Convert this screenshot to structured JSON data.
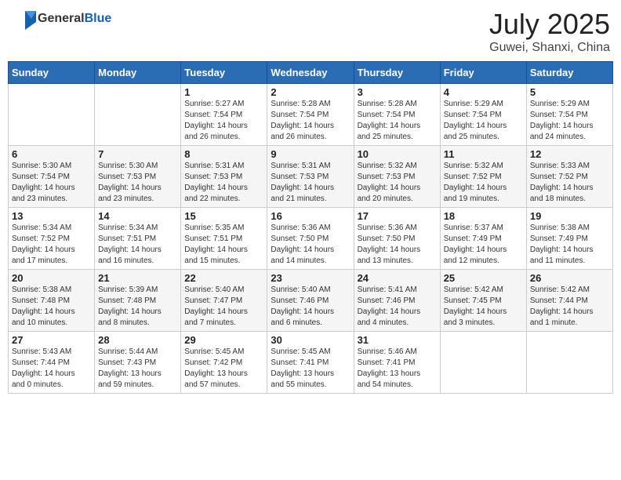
{
  "header": {
    "logo_general": "General",
    "logo_blue": "Blue",
    "month": "July 2025",
    "location": "Guwei, Shanxi, China"
  },
  "weekdays": [
    "Sunday",
    "Monday",
    "Tuesday",
    "Wednesday",
    "Thursday",
    "Friday",
    "Saturday"
  ],
  "weeks": [
    [
      {
        "day": "",
        "info": ""
      },
      {
        "day": "",
        "info": ""
      },
      {
        "day": "1",
        "info": "Sunrise: 5:27 AM\nSunset: 7:54 PM\nDaylight: 14 hours\nand 26 minutes."
      },
      {
        "day": "2",
        "info": "Sunrise: 5:28 AM\nSunset: 7:54 PM\nDaylight: 14 hours\nand 26 minutes."
      },
      {
        "day": "3",
        "info": "Sunrise: 5:28 AM\nSunset: 7:54 PM\nDaylight: 14 hours\nand 25 minutes."
      },
      {
        "day": "4",
        "info": "Sunrise: 5:29 AM\nSunset: 7:54 PM\nDaylight: 14 hours\nand 25 minutes."
      },
      {
        "day": "5",
        "info": "Sunrise: 5:29 AM\nSunset: 7:54 PM\nDaylight: 14 hours\nand 24 minutes."
      }
    ],
    [
      {
        "day": "6",
        "info": "Sunrise: 5:30 AM\nSunset: 7:54 PM\nDaylight: 14 hours\nand 23 minutes."
      },
      {
        "day": "7",
        "info": "Sunrise: 5:30 AM\nSunset: 7:53 PM\nDaylight: 14 hours\nand 23 minutes."
      },
      {
        "day": "8",
        "info": "Sunrise: 5:31 AM\nSunset: 7:53 PM\nDaylight: 14 hours\nand 22 minutes."
      },
      {
        "day": "9",
        "info": "Sunrise: 5:31 AM\nSunset: 7:53 PM\nDaylight: 14 hours\nand 21 minutes."
      },
      {
        "day": "10",
        "info": "Sunrise: 5:32 AM\nSunset: 7:53 PM\nDaylight: 14 hours\nand 20 minutes."
      },
      {
        "day": "11",
        "info": "Sunrise: 5:32 AM\nSunset: 7:52 PM\nDaylight: 14 hours\nand 19 minutes."
      },
      {
        "day": "12",
        "info": "Sunrise: 5:33 AM\nSunset: 7:52 PM\nDaylight: 14 hours\nand 18 minutes."
      }
    ],
    [
      {
        "day": "13",
        "info": "Sunrise: 5:34 AM\nSunset: 7:52 PM\nDaylight: 14 hours\nand 17 minutes."
      },
      {
        "day": "14",
        "info": "Sunrise: 5:34 AM\nSunset: 7:51 PM\nDaylight: 14 hours\nand 16 minutes."
      },
      {
        "day": "15",
        "info": "Sunrise: 5:35 AM\nSunset: 7:51 PM\nDaylight: 14 hours\nand 15 minutes."
      },
      {
        "day": "16",
        "info": "Sunrise: 5:36 AM\nSunset: 7:50 PM\nDaylight: 14 hours\nand 14 minutes."
      },
      {
        "day": "17",
        "info": "Sunrise: 5:36 AM\nSunset: 7:50 PM\nDaylight: 14 hours\nand 13 minutes."
      },
      {
        "day": "18",
        "info": "Sunrise: 5:37 AM\nSunset: 7:49 PM\nDaylight: 14 hours\nand 12 minutes."
      },
      {
        "day": "19",
        "info": "Sunrise: 5:38 AM\nSunset: 7:49 PM\nDaylight: 14 hours\nand 11 minutes."
      }
    ],
    [
      {
        "day": "20",
        "info": "Sunrise: 5:38 AM\nSunset: 7:48 PM\nDaylight: 14 hours\nand 10 minutes."
      },
      {
        "day": "21",
        "info": "Sunrise: 5:39 AM\nSunset: 7:48 PM\nDaylight: 14 hours\nand 8 minutes."
      },
      {
        "day": "22",
        "info": "Sunrise: 5:40 AM\nSunset: 7:47 PM\nDaylight: 14 hours\nand 7 minutes."
      },
      {
        "day": "23",
        "info": "Sunrise: 5:40 AM\nSunset: 7:46 PM\nDaylight: 14 hours\nand 6 minutes."
      },
      {
        "day": "24",
        "info": "Sunrise: 5:41 AM\nSunset: 7:46 PM\nDaylight: 14 hours\nand 4 minutes."
      },
      {
        "day": "25",
        "info": "Sunrise: 5:42 AM\nSunset: 7:45 PM\nDaylight: 14 hours\nand 3 minutes."
      },
      {
        "day": "26",
        "info": "Sunrise: 5:42 AM\nSunset: 7:44 PM\nDaylight: 14 hours\nand 1 minute."
      }
    ],
    [
      {
        "day": "27",
        "info": "Sunrise: 5:43 AM\nSunset: 7:44 PM\nDaylight: 14 hours\nand 0 minutes."
      },
      {
        "day": "28",
        "info": "Sunrise: 5:44 AM\nSunset: 7:43 PM\nDaylight: 13 hours\nand 59 minutes."
      },
      {
        "day": "29",
        "info": "Sunrise: 5:45 AM\nSunset: 7:42 PM\nDaylight: 13 hours\nand 57 minutes."
      },
      {
        "day": "30",
        "info": "Sunrise: 5:45 AM\nSunset: 7:41 PM\nDaylight: 13 hours\nand 55 minutes."
      },
      {
        "day": "31",
        "info": "Sunrise: 5:46 AM\nSunset: 7:41 PM\nDaylight: 13 hours\nand 54 minutes."
      },
      {
        "day": "",
        "info": ""
      },
      {
        "day": "",
        "info": ""
      }
    ]
  ]
}
